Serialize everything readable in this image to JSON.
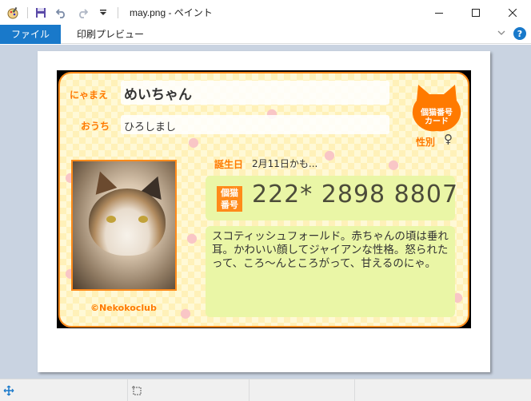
{
  "window": {
    "title": "may.png - ペイント",
    "minimize": "—",
    "maximize": "☐",
    "close": "✕"
  },
  "ribbon": {
    "file_tab": "ファイル",
    "preview_tab": "印刷プレビュー",
    "help": "?"
  },
  "card": {
    "name_label": "にゃまえ",
    "name_value": "めいちゃん",
    "home_label": "おうち",
    "home_value": "ひろしまし",
    "badge_line1": "個猫番号",
    "badge_line2": "カード",
    "sex_label": "性別",
    "sex_value": "♀",
    "birthday_label": "誕生日",
    "birthday_value": "2月11日かも...",
    "number_tag_line1": "個猫",
    "number_tag_line2": "番号",
    "number_value": "222*  2898  8807",
    "description": "スコティッシュフォールド。赤ちゃんの頃は垂れ耳。かわいい顔してジャイアンな性格。怒られたって、ころ〜んところがって、甘えるのにゃ。",
    "copyright": "©Nekokoclub"
  },
  "colors": {
    "accent": "#ff8a1a",
    "ribbon_blue": "#1979ca",
    "workspace": "#c9d3e1",
    "panel": "#eaf6a6"
  }
}
